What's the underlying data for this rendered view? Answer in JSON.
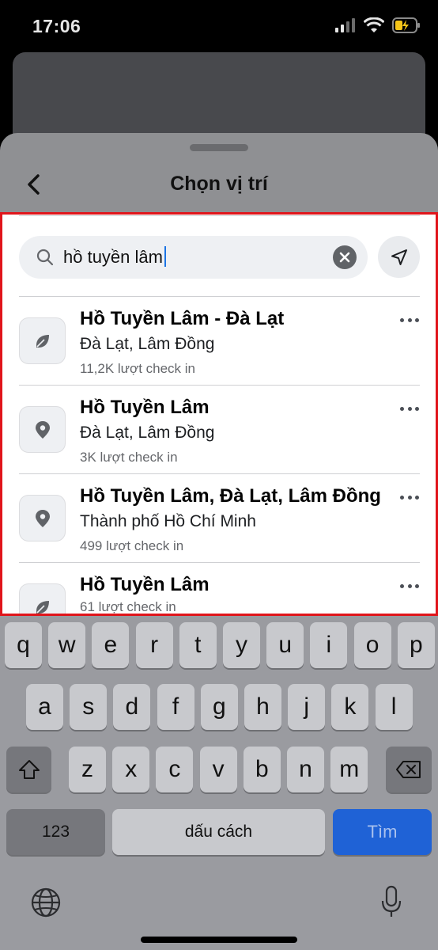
{
  "status_bar": {
    "time": "17:06",
    "icons": [
      "signal-icon",
      "wifi-icon",
      "battery-charging-icon"
    ]
  },
  "sheet": {
    "title": "Chọn vị trí"
  },
  "search": {
    "value": "hồ tuyền lâm"
  },
  "results": [
    {
      "name": "Hồ Tuyền Lâm - Đà Lạt",
      "sub": "Đà Lạt, Lâm Đồng",
      "meta": "11,2K lượt check in",
      "icon": "leaf-icon"
    },
    {
      "name": "Hồ Tuyền Lâm",
      "sub": "Đà Lạt, Lâm Đồng",
      "meta": "3K lượt check in",
      "icon": "map-pin-icon"
    },
    {
      "name": "Hồ Tuyền Lâm, Đà Lạt, Lâm Đồng",
      "sub": "Thành phố Hồ Chí Minh",
      "meta": "499 lượt check in",
      "icon": "map-pin-icon"
    },
    {
      "name": "Hồ Tuyền Lâm",
      "sub": "",
      "meta": "61 lượt check in",
      "icon": "leaf-icon"
    }
  ],
  "keyboard": {
    "row1": [
      "q",
      "w",
      "e",
      "r",
      "t",
      "y",
      "u",
      "i",
      "o",
      "p"
    ],
    "row2": [
      "a",
      "s",
      "d",
      "f",
      "g",
      "h",
      "j",
      "k",
      "l"
    ],
    "row3": [
      "z",
      "x",
      "c",
      "v",
      "b",
      "n",
      "m"
    ],
    "numbers_label": "123",
    "space_label": "dấu cách",
    "return_label": "Tìm"
  },
  "colors": {
    "accent": "#1f62d6",
    "highlight": "#e0151b",
    "sheet_bg": "#8f9093"
  }
}
